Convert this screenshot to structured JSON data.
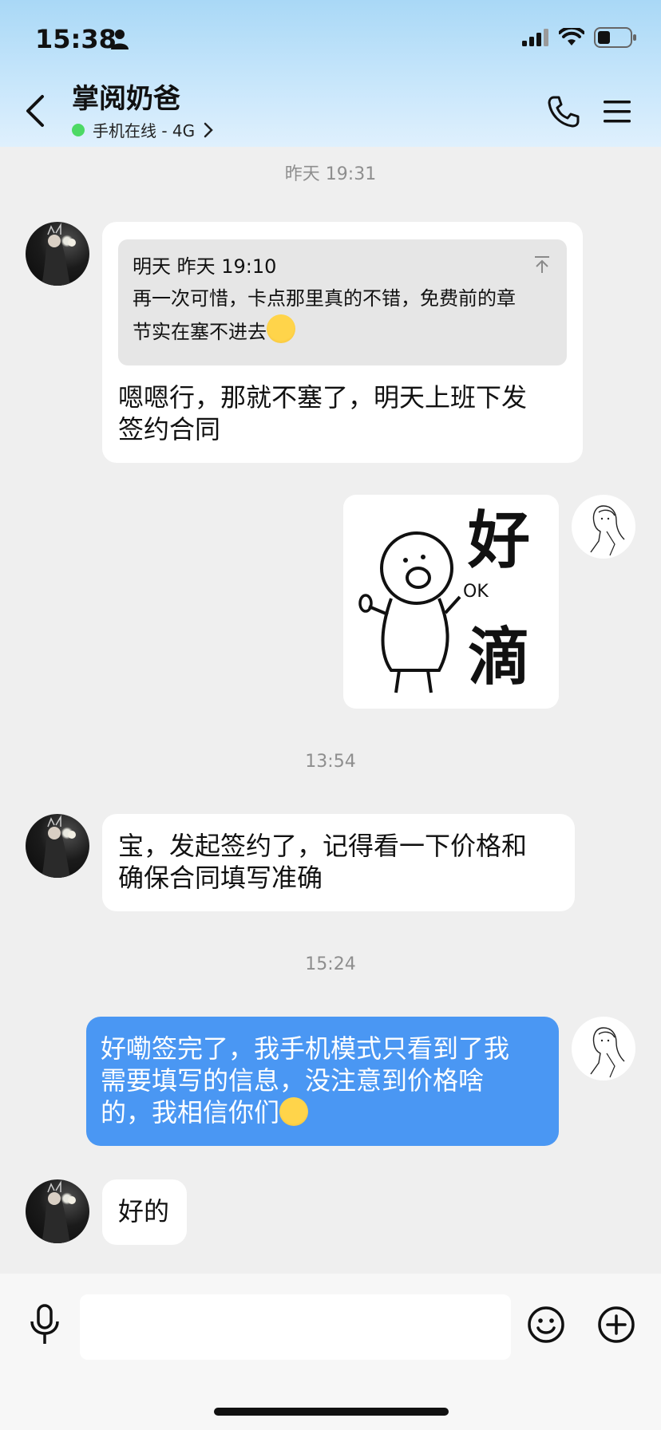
{
  "status_bar": {
    "time": "15:38"
  },
  "header": {
    "title": "掌阅奶爸",
    "online_status": "手机在线 - 4G"
  },
  "messages": {
    "ts1": "昨天 19:31",
    "quote_header": "明天  昨天 19:10",
    "quote_line1": "再一次可惜，卡点那里真的不错，免费前的章",
    "quote_line2": "节实在塞不进去",
    "reply_line1": "嗯嗯行，那就不塞了，明天上班下发",
    "reply_line2": "签约合同",
    "sticker_text_1": "好",
    "sticker_text_2": "滴",
    "sticker_ok": "OK",
    "ts2": "13:54",
    "msg2_line1": "宝，发起签约了，记得看一下价格和",
    "msg2_line2": "确保合同填写准确",
    "ts3": "15:24",
    "msg3_line1": "好嘞签完了，我手机模式只看到了我",
    "msg3_line2": "需要填写的信息，没注意到价格啥",
    "msg3_line3": "的，我相信你们",
    "msg4": "好的"
  },
  "colors": {
    "header_gradient_top": "#a9d8f6",
    "blue_bubble": "#4a97f3",
    "online_dot": "#4cd964",
    "background": "#efefef"
  },
  "icons": [
    "person-icon",
    "signal-icon",
    "wifi-icon",
    "battery-icon",
    "back-chevron-icon",
    "chevron-right-icon",
    "phone-icon",
    "hamburger-menu-icon",
    "pin-to-top-icon",
    "mic-icon",
    "emoji-icon",
    "plus-icon"
  ]
}
